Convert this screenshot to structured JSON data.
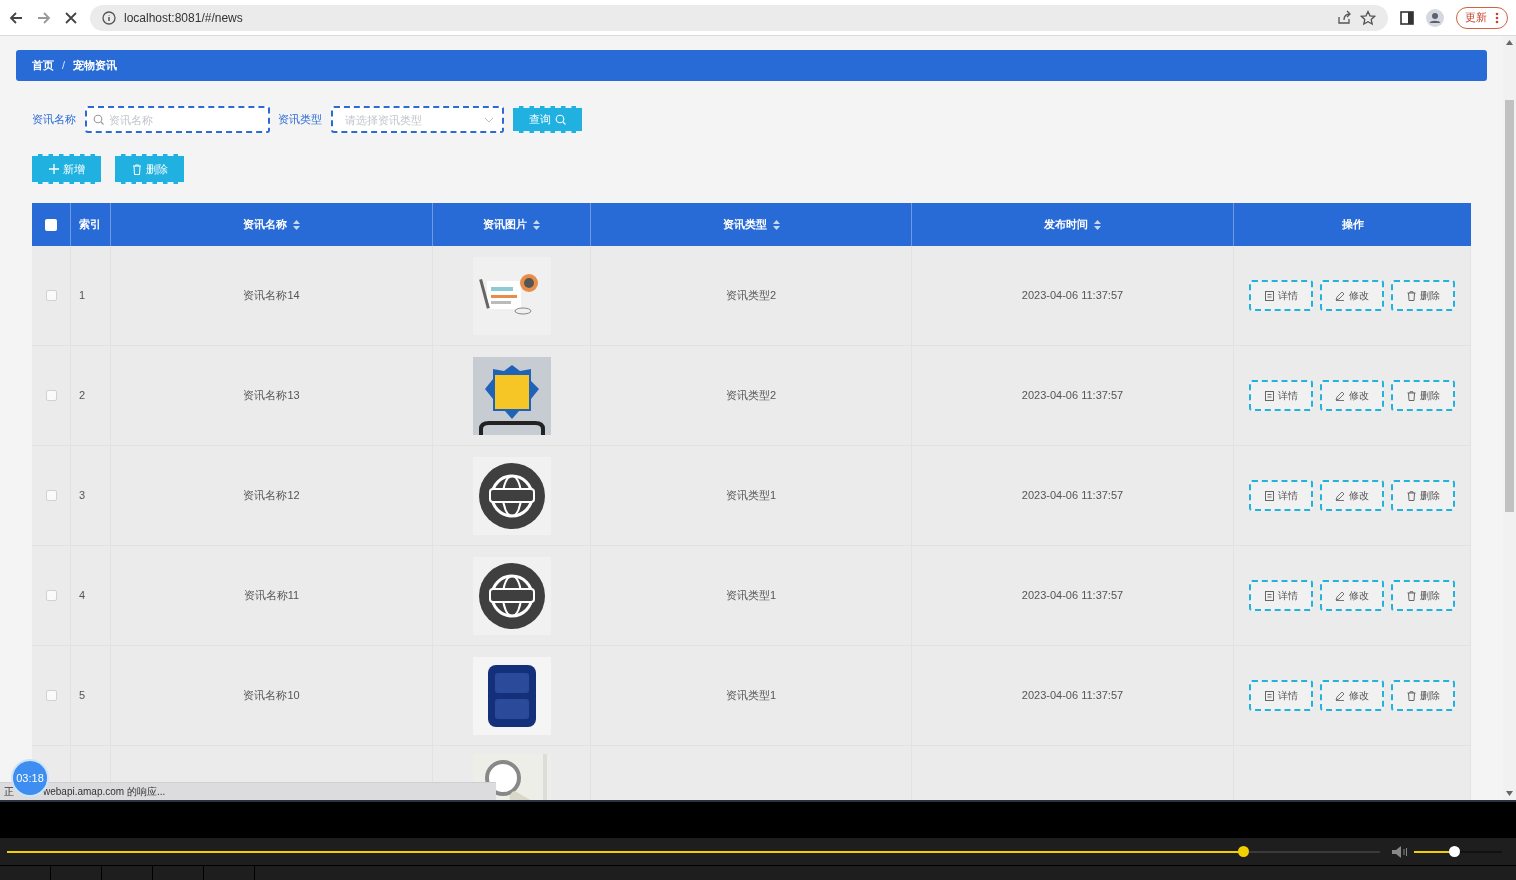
{
  "browser": {
    "url": "localhost:8081/#/news",
    "update_button": "更新"
  },
  "breadcrumb": [
    "首页",
    "/",
    "宠物资讯"
  ],
  "search": {
    "name_label": "资讯名称",
    "name_placeholder": "资讯名称",
    "type_label": "资讯类型",
    "type_placeholder": "请选择资讯类型",
    "query_button": "查询"
  },
  "actions": [
    {
      "kind": "add",
      "label": "新增"
    },
    {
      "kind": "delete",
      "label": "删除"
    }
  ],
  "table": {
    "select_all": {
      "checked": false
    },
    "columns": [
      {
        "label": "索引",
        "sortable": false
      },
      {
        "label": "资讯名称",
        "sortable": true
      },
      {
        "label": "资讯图片",
        "sortable": true
      },
      {
        "label": "资讯类型",
        "sortable": true
      },
      {
        "label": "发布时间",
        "sortable": true
      },
      {
        "label": "操作",
        "sortable": false
      }
    ],
    "rows": [
      {
        "checked": false,
        "index": "1",
        "name": "资讯名称14",
        "type": "资讯类型2",
        "time": "2023-04-06 11:37:57",
        "buttons": [
          "详情",
          "修改",
          "删除"
        ]
      },
      {
        "checked": false,
        "index": "2",
        "name": "资讯名称13",
        "type": "资讯类型2",
        "time": "2023-04-06 11:37:57",
        "buttons": [
          "详情",
          "修改",
          "删除"
        ]
      },
      {
        "checked": false,
        "index": "3",
        "name": "资讯名称12",
        "type": "资讯类型1",
        "time": "2023-04-06 11:37:57",
        "buttons": [
          "详情",
          "修改",
          "删除"
        ]
      },
      {
        "checked": false,
        "index": "4",
        "name": "资讯名称11",
        "type": "资讯类型1",
        "time": "2023-04-06 11:37:57",
        "buttons": [
          "详情",
          "修改",
          "删除"
        ]
      },
      {
        "checked": false,
        "index": "5",
        "name": "资讯名称10",
        "type": "资讯类型1",
        "time": "2023-04-06 11:37:57",
        "buttons": [
          "详情",
          "修改",
          "删除"
        ]
      }
    ]
  },
  "status_bar": {
    "text_start": "正",
    "text": "webapi.amap.com 的响应..."
  },
  "timer_badge": "03:18",
  "player": {
    "progress": {
      "level": 0.9
    },
    "volume": {
      "level": 0.45
    }
  }
}
